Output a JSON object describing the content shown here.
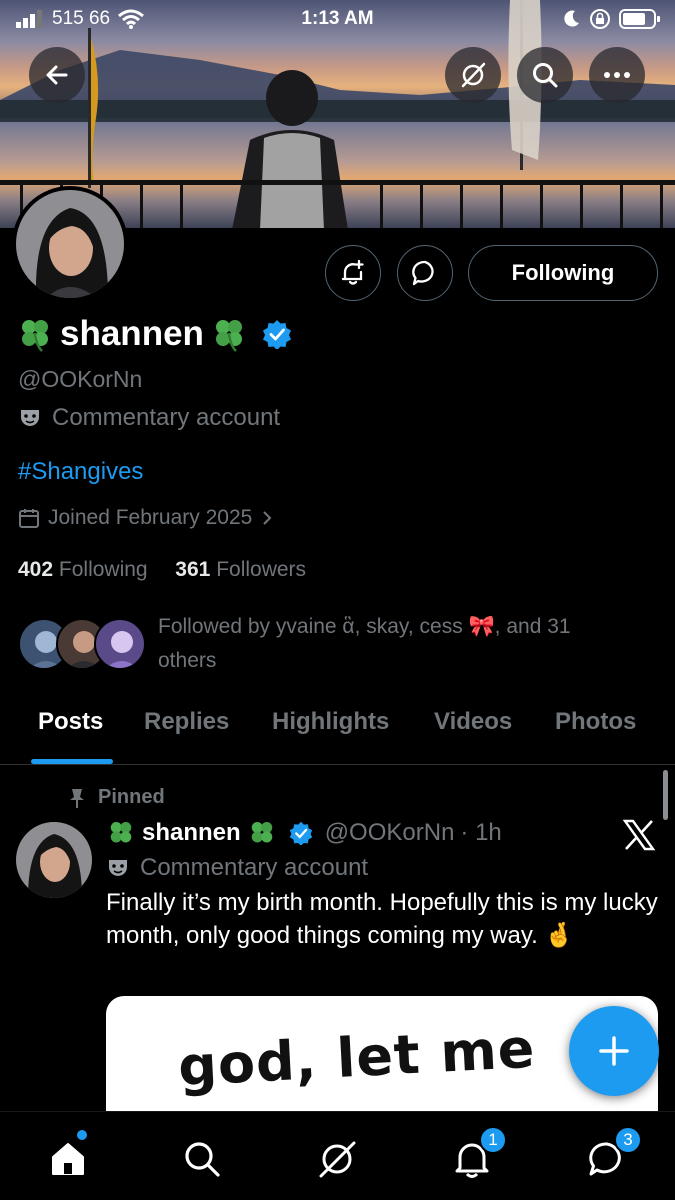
{
  "status_bar": {
    "carrier": "515 66",
    "time": "1:13 AM"
  },
  "header": {
    "back_icon": "arrow-left-icon",
    "grok_icon": "grok-slash-icon",
    "search_icon": "search-icon",
    "more_icon": "more-dots-icon"
  },
  "profile": {
    "display_name": "shannen",
    "name_emoji": "four-leaf-clover",
    "verified": true,
    "handle": "@OOKorNn",
    "label": "Commentary account",
    "label_icon": "theater-mask-icon",
    "bio_hashtag": "#Shangives",
    "joined": "Joined February 2025",
    "following_count": "402",
    "following_label": "Following",
    "followers_count": "361",
    "followers_label": "Followers",
    "followed_by": "Followed by yvaine ἃ, skay, cess 🎀, and 31 others"
  },
  "actions": {
    "notify_icon": "bell-plus-icon",
    "message_icon": "message-bubble-icon",
    "following_button": "Following"
  },
  "tabs": [
    {
      "label": "Posts",
      "active": true
    },
    {
      "label": "Replies",
      "active": false
    },
    {
      "label": "Highlights",
      "active": false
    },
    {
      "label": "Videos",
      "active": false
    },
    {
      "label": "Photos",
      "active": false
    }
  ],
  "pinned_post": {
    "pinned_label": "Pinned",
    "author_name": "shannen",
    "author_handle": "@OOKorNn",
    "time": "· 1h",
    "label": "Commentary account",
    "text": "Finally it’s my birth month. Hopefully this is my lucky month,  only good things coming my way. 🤞",
    "media_text": "god, let me"
  },
  "bottom_nav": {
    "notifications_badge": "1",
    "messages_badge": "3"
  },
  "colors": {
    "accent": "#1d9bf0",
    "background": "#000000",
    "muted": "#71767b",
    "verified": "#1d9bf0"
  }
}
